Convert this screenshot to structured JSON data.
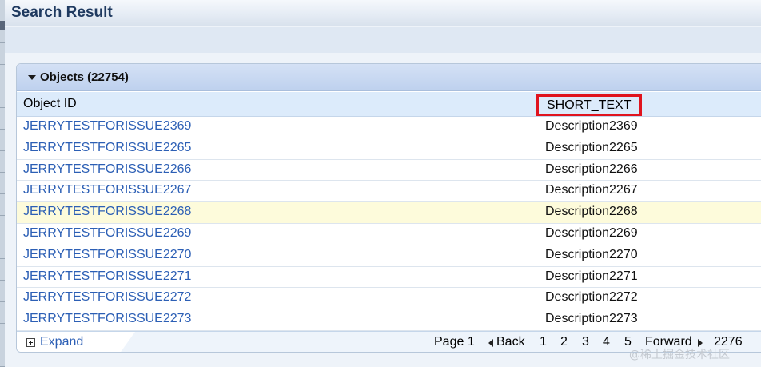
{
  "window": {
    "title": "Search Result"
  },
  "panel": {
    "header_title": "Objects (22754)",
    "columns": {
      "object_id": "Object ID",
      "short_text": "SHORT_TEXT"
    },
    "rows": [
      {
        "id": "JERRYTESTFORISSUE2369",
        "desc": "Description2369"
      },
      {
        "id": "JERRYTESTFORISSUE2265",
        "desc": "Description2265"
      },
      {
        "id": "JERRYTESTFORISSUE2266",
        "desc": "Description2266"
      },
      {
        "id": "JERRYTESTFORISSUE2267",
        "desc": "Description2267"
      },
      {
        "id": "JERRYTESTFORISSUE2268",
        "desc": "Description2268"
      },
      {
        "id": "JERRYTESTFORISSUE2269",
        "desc": "Description2269"
      },
      {
        "id": "JERRYTESTFORISSUE2270",
        "desc": "Description2270"
      },
      {
        "id": "JERRYTESTFORISSUE2271",
        "desc": "Description2271"
      },
      {
        "id": "JERRYTESTFORISSUE2272",
        "desc": "Description2272"
      },
      {
        "id": "JERRYTESTFORISSUE2273",
        "desc": "Description2273"
      }
    ],
    "highlighted_row": 4
  },
  "footer": {
    "expand_label": "Expand",
    "page_label": "Page 1",
    "back_label": "Back",
    "current_page": "1",
    "pages": [
      "2",
      "3",
      "4",
      "5"
    ],
    "forward_label": "Forward",
    "last_page": "2276"
  },
  "watermark": "@稀土掘金技术社区",
  "colors": {
    "link": "#2c5fb5",
    "highlight": "#e0141e",
    "header_bg": "#bed1ee",
    "row_hover": "#fdfbdb"
  },
  "icons": [
    "collapse-caret-icon",
    "expand-plus-icon",
    "back-arrow-icon",
    "forward-arrow-icon"
  ]
}
